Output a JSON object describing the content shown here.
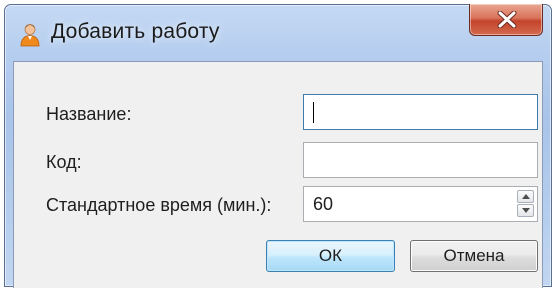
{
  "window": {
    "title": "Добавить работу",
    "icon": "user-icon",
    "close_icon": "close-icon"
  },
  "form": {
    "name_label": "Название:",
    "name_value": "",
    "code_label": "Код:",
    "code_value": "",
    "time_label": "Стандартное время (мин.):",
    "time_value": "60"
  },
  "buttons": {
    "ok_label": "ОК",
    "cancel_label": "Отмена"
  },
  "colors": {
    "title_glass": "#b5cdef",
    "close_red": "#c2452b",
    "ok_border": "#3c7fb1",
    "client_bg": "#f0f0f0"
  }
}
